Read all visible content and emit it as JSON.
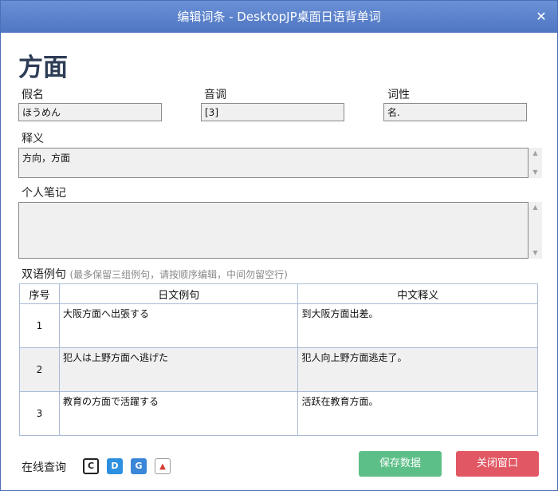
{
  "window": {
    "title": "编辑词条 - DesktopJP桌面日语背单词",
    "close_glyph": "✕"
  },
  "entry": {
    "word": "方面",
    "kana_label": "假名",
    "kana_value": "ほうめん",
    "tone_label": "音调",
    "tone_value": "[3]",
    "pos_label": "词性",
    "pos_value": "名.",
    "meaning_label": "释义",
    "meaning_value": "方向，方面",
    "note_label": "个人笔记",
    "note_value": ""
  },
  "examples": {
    "label": "双语例句",
    "hint": "(最多保留三组例句，请按顺序编辑，中间勿留空行)",
    "columns": [
      "序号",
      "日文例句",
      "中文释义"
    ],
    "rows": [
      {
        "num": "1",
        "jp": "大阪方面へ出張する",
        "cn": "到大阪方面出差。"
      },
      {
        "num": "2",
        "jp": "犯人は上野方面へ逃げた",
        "cn": "犯人向上野方面逃走了。"
      },
      {
        "num": "3",
        "jp": "教育の方面で活躍する",
        "cn": "活跃在教育方面。"
      }
    ]
  },
  "footer": {
    "online_label": "在线查询",
    "dict_icons": [
      {
        "name": "dict-c-icon",
        "glyph": "C",
        "color": "#222222"
      },
      {
        "name": "dict-d-icon",
        "glyph": "D",
        "color": "#2d8fe0"
      },
      {
        "name": "dict-g-icon",
        "glyph": "G",
        "color": "#3a86d8"
      },
      {
        "name": "dict-mountain-icon",
        "glyph": "▲",
        "color": "#d43b2e"
      }
    ],
    "save_label": "保存数据",
    "close_label": "关闭窗口"
  }
}
